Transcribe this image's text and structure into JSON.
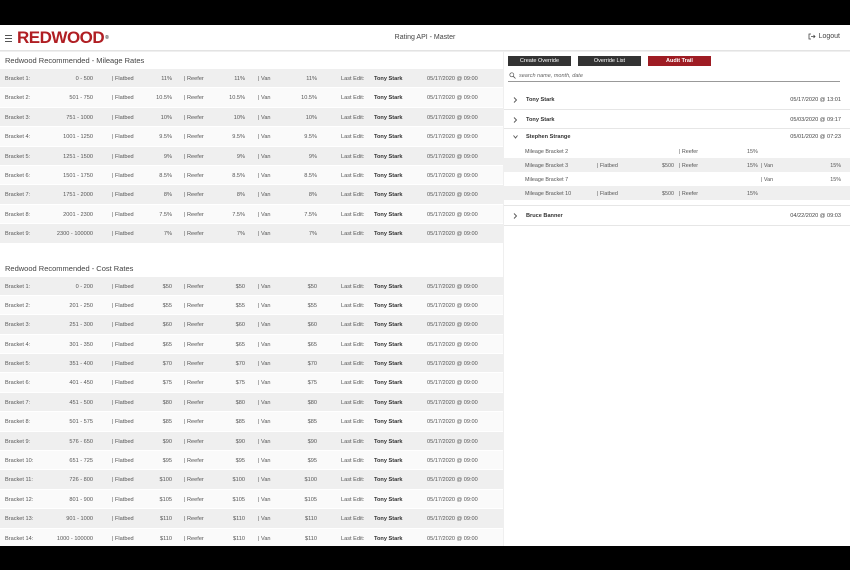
{
  "header": {
    "logo": "REDWOOD",
    "logo_mark": "®",
    "title": "Rating API - Master",
    "logout": "Logout"
  },
  "mileage": {
    "title": "Redwood Recommended - Mileage Rates",
    "rows": [
      {
        "bracket": "Bracket 1:",
        "range": "0 - 500",
        "flatbed": "11%",
        "reefer": "11%",
        "van": "11%",
        "editor": "Tony Stark",
        "date": "05/17/2020 @ 09:00"
      },
      {
        "bracket": "Bracket 2:",
        "range": "501 - 750",
        "flatbed": "10.5%",
        "reefer": "10.5%",
        "van": "10.5%",
        "editor": "Tony Stark",
        "date": "05/17/2020 @ 09:00"
      },
      {
        "bracket": "Bracket 3:",
        "range": "751 - 1000",
        "flatbed": "10%",
        "reefer": "10%",
        "van": "10%",
        "editor": "Tony Stark",
        "date": "05/17/2020 @ 09:00"
      },
      {
        "bracket": "Bracket 4:",
        "range": "1001 - 1250",
        "flatbed": "9.5%",
        "reefer": "9.5%",
        "van": "9.5%",
        "editor": "Tony Stark",
        "date": "05/17/2020 @ 09:00"
      },
      {
        "bracket": "Bracket 5:",
        "range": "1251 - 1500",
        "flatbed": "9%",
        "reefer": "9%",
        "van": "9%",
        "editor": "Tony Stark",
        "date": "05/17/2020 @ 09:00"
      },
      {
        "bracket": "Bracket 6:",
        "range": "1501 - 1750",
        "flatbed": "8.5%",
        "reefer": "8.5%",
        "van": "8.5%",
        "editor": "Tony Stark",
        "date": "05/17/2020 @ 09:00"
      },
      {
        "bracket": "Bracket 7:",
        "range": "1751 - 2000",
        "flatbed": "8%",
        "reefer": "8%",
        "van": "8%",
        "editor": "Tony Stark",
        "date": "05/17/2020 @ 09:00"
      },
      {
        "bracket": "Bracket 8:",
        "range": "2001 - 2300",
        "flatbed": "7.5%",
        "reefer": "7.5%",
        "van": "7.5%",
        "editor": "Tony Stark",
        "date": "05/17/2020 @ 09:00"
      },
      {
        "bracket": "Bracket 9:",
        "range": "2300 - 100000",
        "flatbed": "7%",
        "reefer": "7%",
        "van": "7%",
        "editor": "Tony Stark",
        "date": "05/17/2020 @ 09:00"
      }
    ]
  },
  "cost": {
    "title": "Redwood Recommended - Cost Rates",
    "rows": [
      {
        "bracket": "Bracket 1:",
        "range": "0 - 200",
        "flatbed": "$50",
        "reefer": "$50",
        "van": "$50",
        "editor": "Tony Stark",
        "date": "05/17/2020 @ 09:00"
      },
      {
        "bracket": "Bracket 2:",
        "range": "201 - 250",
        "flatbed": "$55",
        "reefer": "$55",
        "van": "$55",
        "editor": "Tony Stark",
        "date": "05/17/2020 @ 09:00"
      },
      {
        "bracket": "Bracket 3:",
        "range": "251 - 300",
        "flatbed": "$60",
        "reefer": "$60",
        "van": "$60",
        "editor": "Tony Stark",
        "date": "05/17/2020 @ 09:00"
      },
      {
        "bracket": "Bracket 4:",
        "range": "301 - 350",
        "flatbed": "$65",
        "reefer": "$65",
        "van": "$65",
        "editor": "Tony Stark",
        "date": "05/17/2020 @ 09:00"
      },
      {
        "bracket": "Bracket 5:",
        "range": "351 - 400",
        "flatbed": "$70",
        "reefer": "$70",
        "van": "$70",
        "editor": "Tony Stark",
        "date": "05/17/2020 @ 09:00"
      },
      {
        "bracket": "Bracket 6:",
        "range": "401 - 450",
        "flatbed": "$75",
        "reefer": "$75",
        "van": "$75",
        "editor": "Tony Stark",
        "date": "05/17/2020 @ 09:00"
      },
      {
        "bracket": "Bracket 7:",
        "range": "451 - 500",
        "flatbed": "$80",
        "reefer": "$80",
        "van": "$80",
        "editor": "Tony Stark",
        "date": "05/17/2020 @ 09:00"
      },
      {
        "bracket": "Bracket 8:",
        "range": "501 - 575",
        "flatbed": "$85",
        "reefer": "$85",
        "van": "$85",
        "editor": "Tony Stark",
        "date": "05/17/2020 @ 09:00"
      },
      {
        "bracket": "Bracket 9:",
        "range": "576 - 650",
        "flatbed": "$90",
        "reefer": "$90",
        "van": "$90",
        "editor": "Tony Stark",
        "date": "05/17/2020 @ 09:00"
      },
      {
        "bracket": "Bracket 10:",
        "range": "651 - 725",
        "flatbed": "$95",
        "reefer": "$95",
        "van": "$95",
        "editor": "Tony Stark",
        "date": "05/17/2020 @ 09:00"
      },
      {
        "bracket": "Bracket 11:",
        "range": "726 - 800",
        "flatbed": "$100",
        "reefer": "$100",
        "van": "$100",
        "editor": "Tony Stark",
        "date": "05/17/2020 @ 09:00"
      },
      {
        "bracket": "Bracket 12:",
        "range": "801 - 900",
        "flatbed": "$105",
        "reefer": "$105",
        "van": "$105",
        "editor": "Tony Stark",
        "date": "05/17/2020 @ 09:00"
      },
      {
        "bracket": "Bracket 13:",
        "range": "901 - 1000",
        "flatbed": "$110",
        "reefer": "$110",
        "van": "$110",
        "editor": "Tony Stark",
        "date": "05/17/2020 @ 09:00"
      },
      {
        "bracket": "Bracket 14:",
        "range": "1000 - 100000",
        "flatbed": "$110",
        "reefer": "$110",
        "van": "$110",
        "editor": "Tony Stark",
        "date": "05/17/2020 @ 09:00"
      }
    ]
  },
  "labels": {
    "flatbed": "| Flatbed",
    "reefer": "| Reefer",
    "van": "| Van",
    "last_edit": "Last Edit:"
  },
  "actions": {
    "create_override": "Create Override",
    "override_list": "Override List",
    "audit_trail": "Audit Trail"
  },
  "search": {
    "placeholder": "search name, month, date"
  },
  "audit": {
    "entries": [
      {
        "name": "Tony Stark",
        "date": "05/17/2020 @ 13:01",
        "expanded": false
      },
      {
        "name": "Tony Stark",
        "date": "05/03/2020 @ 09:17",
        "expanded": false
      },
      {
        "name": "Stephen Strange",
        "date": "05/01/2020 @ 07:23",
        "expanded": true,
        "details": [
          {
            "name": "Mileage Bracket 2",
            "t1": "",
            "v1": "",
            "t2": "| Reefer",
            "v2": "15%",
            "t3": "",
            "v3": ""
          },
          {
            "name": "Mileage Bracket 3",
            "t1": "| Flatbed",
            "v1": "$500",
            "t2": "| Reefer",
            "v2": "15%",
            "t3": "| Van",
            "v3": "15%"
          },
          {
            "name": "Mileage Bracket 7",
            "t1": "",
            "v1": "",
            "t2": "",
            "v2": "",
            "t3": "| Van",
            "v3": "15%"
          },
          {
            "name": "Mileage Bracket 10",
            "t1": "| Flatbed",
            "v1": "$500",
            "t2": "| Reefer",
            "v2": "15%",
            "t3": "",
            "v3": ""
          }
        ]
      },
      {
        "name": "Bruce Banner",
        "date": "04/22/2020 @ 09:03",
        "expanded": false
      }
    ]
  },
  "colors": {
    "brand": "#b01e23",
    "button": "#333333",
    "active_button": "#9e1c23"
  },
  "icons": {
    "menu": "hamburger-icon",
    "logout": "logout-icon",
    "search": "search-icon",
    "collapsed": "chevron-right-icon",
    "expanded": "chevron-down-icon"
  }
}
